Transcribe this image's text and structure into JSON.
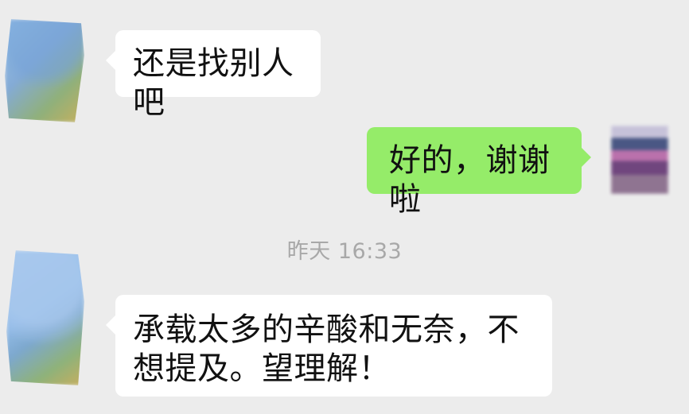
{
  "messages": [
    {
      "text": "还是找别人吧"
    },
    {
      "text": "好的，谢谢啦"
    },
    {
      "text": "承载太多的辛酸和无奈，不想提及。望理解！"
    }
  ],
  "timestamp": "昨天 16:33",
  "colors": {
    "chat_background": "#ececec",
    "incoming_bubble": "#ffffff",
    "outgoing_bubble": "#95ec69",
    "timestamp_text": "#a8a8a8"
  }
}
